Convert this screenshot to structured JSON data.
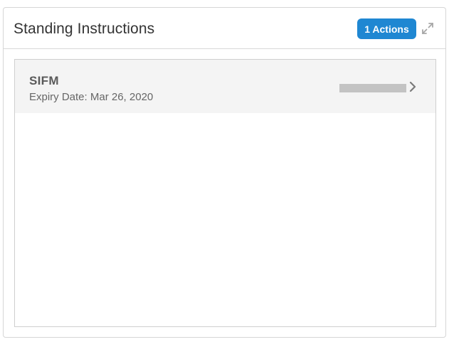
{
  "widget": {
    "title": "Standing Instructions",
    "actions_label": "1 Actions",
    "accent_color": "#1f87d2",
    "expand_icon": "expand-arrows-icon"
  },
  "instructions": [
    {
      "name": "SIFM",
      "expiry": "Expiry Date: Mar 26, 2020",
      "value_redacted": true,
      "chevron_icon": "chevron-right-icon"
    }
  ]
}
